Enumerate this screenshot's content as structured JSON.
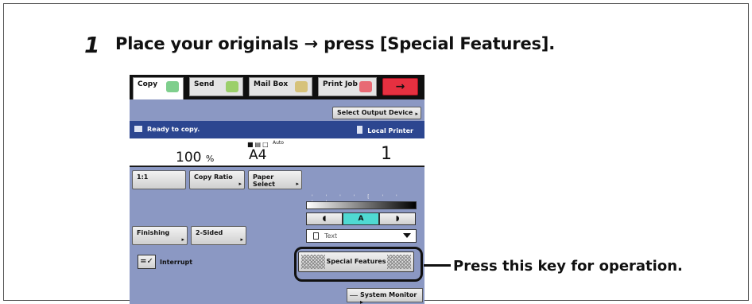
{
  "instruction": {
    "step_number": "1",
    "text": "Place your originals → press [Special Features]."
  },
  "tabs": [
    {
      "label": "Copy",
      "icon": "copy-machine-icon"
    },
    {
      "label": "Send",
      "icon": "send-icon"
    },
    {
      "label": "Mail Box",
      "icon": "mailbox-icon"
    },
    {
      "label": "Print Job",
      "icon": "printer-icon"
    }
  ],
  "next_arrow": "→",
  "select_output_device": "Select Output Device",
  "status": {
    "message": "Ready to copy.",
    "printer": "Local Printer"
  },
  "info": {
    "ratio_value": "100",
    "ratio_unit": "%",
    "paper_icons": "■▤□",
    "paper_mode": "Auto",
    "paper_size": "A4",
    "quantity": "1"
  },
  "buttons": {
    "one_to_one": "1:1",
    "copy_ratio": "Copy Ratio",
    "paper_select": "Paper Select",
    "finishing": "Finishing",
    "two_sided": "2-Sided",
    "interrupt_icon": "=✓",
    "interrupt": "Interrupt",
    "special_features": "Special Features",
    "system_monitor": "System Monitor"
  },
  "density": {
    "scale": "' ' ' ' [ ' ' ' '",
    "lighter": "◖",
    "auto": "A",
    "darker": "◗"
  },
  "original_type": "Text",
  "callout": "Press this key for operation."
}
